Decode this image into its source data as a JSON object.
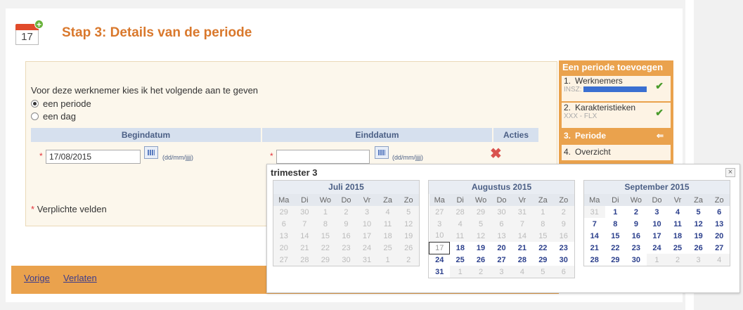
{
  "page": {
    "step_title": "Stap 3: Details van de periode",
    "calendar_day": "17"
  },
  "form": {
    "question": "Voor deze werknemer kies ik het volgende aan te geven",
    "options": [
      "een periode",
      "een dag"
    ],
    "selected_option": "een periode",
    "columns": [
      "Begindatum",
      "Einddatum",
      "Acties"
    ],
    "begin_value": "17/08/2015",
    "end_value": "",
    "date_format": "(dd/mm/jjjj)",
    "required_star": "*",
    "required_note": "Verplichte velden"
  },
  "footer": {
    "prev_label": "Vorige",
    "exit_label": "Verlaten"
  },
  "steps_panel": {
    "header": "Een periode toevoegen",
    "steps": [
      {
        "num": "1.",
        "label": "Werknemers",
        "sub": "INSZ:",
        "done": true
      },
      {
        "num": "2.",
        "label": "Karakteristieken",
        "sub": "XXX - FLX",
        "done": true
      },
      {
        "num": "3.",
        "label": "Periode",
        "active": true
      },
      {
        "num": "4.",
        "label": "Overzicht"
      }
    ]
  },
  "popup": {
    "title": "trimester 3",
    "close": "×",
    "weekdays": [
      "Ma",
      "Di",
      "Wo",
      "Do",
      "Vr",
      "Za",
      "Zo"
    ],
    "months": [
      {
        "name": "Juli 2015",
        "weeks": [
          [
            "29",
            "30",
            "1",
            "2",
            "3",
            "4",
            "5"
          ],
          [
            "6",
            "7",
            "8",
            "9",
            "10",
            "11",
            "12"
          ],
          [
            "13",
            "14",
            "15",
            "16",
            "17",
            "18",
            "19"
          ],
          [
            "20",
            "21",
            "22",
            "23",
            "24",
            "25",
            "26"
          ],
          [
            "27",
            "28",
            "29",
            "30",
            "31",
            "1",
            "2"
          ]
        ]
      },
      {
        "name": "Augustus 2015",
        "weeks": [
          [
            "27",
            "28",
            "29",
            "30",
            "31",
            "1",
            "2"
          ],
          [
            "3",
            "4",
            "5",
            "6",
            "7",
            "8",
            "9"
          ],
          [
            "10",
            "11",
            "12",
            "13",
            "14",
            "15",
            "16"
          ],
          [
            "17",
            "18",
            "19",
            "20",
            "21",
            "22",
            "23"
          ],
          [
            "24",
            "25",
            "26",
            "27",
            "28",
            "29",
            "30"
          ],
          [
            "31",
            "1",
            "2",
            "3",
            "4",
            "5",
            "6"
          ]
        ]
      },
      {
        "name": "September 2015",
        "weeks": [
          [
            "31",
            "1",
            "2",
            "3",
            "4",
            "5",
            "6"
          ],
          [
            "7",
            "8",
            "9",
            "10",
            "11",
            "12",
            "13"
          ],
          [
            "14",
            "15",
            "16",
            "17",
            "18",
            "19",
            "20"
          ],
          [
            "21",
            "22",
            "23",
            "24",
            "25",
            "26",
            "27"
          ],
          [
            "28",
            "29",
            "30",
            "1",
            "2",
            "3",
            "4"
          ]
        ]
      }
    ]
  }
}
